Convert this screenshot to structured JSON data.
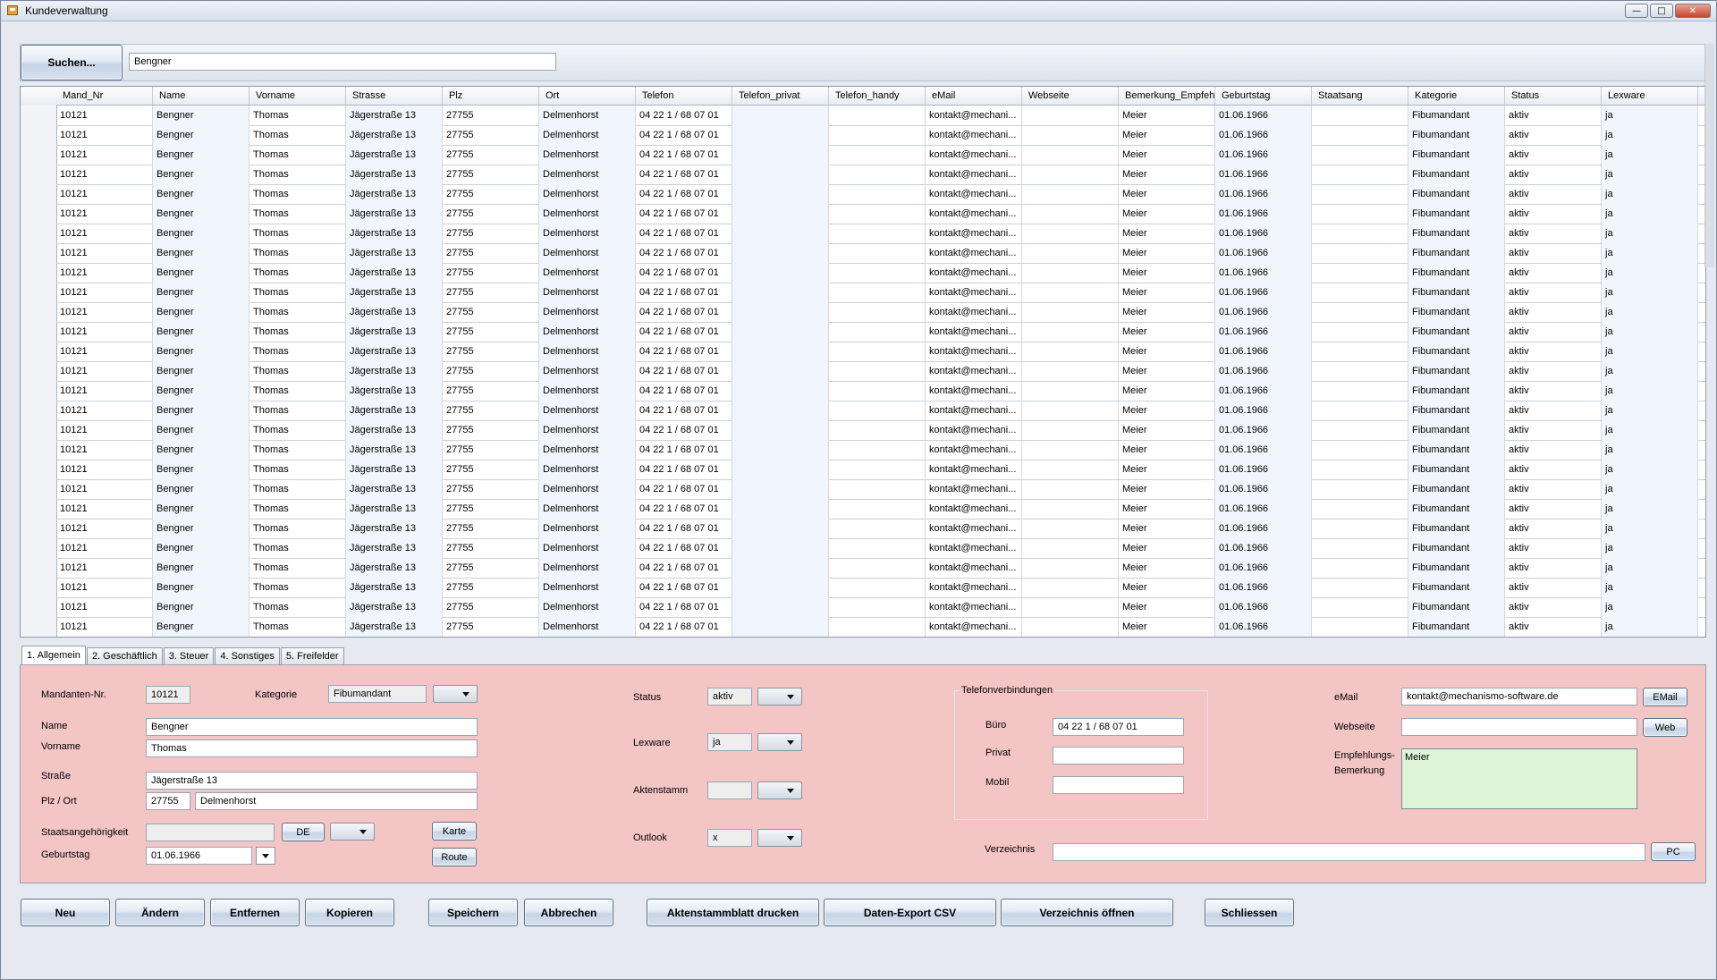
{
  "window": {
    "title": "Kundeverwaltung"
  },
  "search": {
    "button_label": "Suchen...",
    "value": "Bengner"
  },
  "grid": {
    "columns": [
      "Mand_Nr",
      "Name",
      "Vorname",
      "Strasse",
      "Plz",
      "Ort",
      "Telefon",
      "Telefon_privat",
      "Telefon_handy",
      "eMail",
      "Webseite",
      "Bemerkung_Empfehlung",
      "Geburtstag",
      "Staatsang",
      "Kategorie",
      "Status",
      "Lexware"
    ],
    "row_template": [
      "10121",
      "Bengner",
      "Thomas",
      "Jägerstraße 13",
      "27755",
      "Delmenhorst",
      "04 22 1 / 68 07 01",
      "",
      "",
      "kontakt@mechani...",
      "",
      "Meier",
      "01.06.1966",
      "",
      "Fibumandant",
      "aktiv",
      "ja"
    ],
    "row_count": 27
  },
  "tabs": [
    "1. Allgemein",
    "2. Geschäftlich",
    "3. Steuer",
    "4. Sonstiges",
    "5. Freifelder"
  ],
  "form": {
    "mandant_label": "Mandanten-Nr.",
    "mandant_value": "10121",
    "kategorie_label": "Kategorie",
    "kategorie_value": "Fibumandant",
    "name_label": "Name",
    "name_value": "Bengner",
    "vorname_label": "Vorname",
    "vorname_value": "Thomas",
    "strasse_label": "Straße",
    "strasse_value": "Jägerstraße 13",
    "plzort_label": "Plz / Ort",
    "plz_value": "27755",
    "ort_value": "Delmenhorst",
    "staat_label": "Staatsangehörigkeit",
    "staat_value": "",
    "de_button": "DE",
    "karte_button": "Karte",
    "geburtstag_label": "Geburtstag",
    "geburtstag_value": "01.06.1966",
    "route_button": "Route",
    "status_label": "Status",
    "status_value": "aktiv",
    "lexware_label": "Lexware",
    "lexware_value": "ja",
    "aktenstamm_label": "Aktenstamm",
    "aktenstamm_value": "",
    "outlook_label": "Outlook",
    "outlook_value": "x",
    "telefon_group": "Telefonverbindungen",
    "buero_label": "Büro",
    "buero_value": "04 22 1 / 68 07 01",
    "privat_label": "Privat",
    "privat_value": "",
    "mobil_label": "Mobil",
    "mobil_value": "",
    "email_label": "eMail",
    "email_value": "kontakt@mechanismo-software.de",
    "email_button": "EMail",
    "webseite_label": "Webseite",
    "webseite_value": "",
    "web_button": "Web",
    "empfehlung_label_1": "Empfehlungs-",
    "empfehlung_label_2": "Bemerkung",
    "empfehlung_value": "Meier",
    "verzeichnis_label": "Verzeichnis",
    "verzeichnis_value": "",
    "pc_button": "PC"
  },
  "actions": {
    "neu": "Neu",
    "aendern": "Ändern",
    "entfernen": "Entfernen",
    "kopieren": "Kopieren",
    "speichern": "Speichern",
    "abbrechen": "Abbrechen",
    "aktenstammblatt": "Aktenstammblatt drucken",
    "export": "Daten-Export CSV",
    "verzeichnis": "Verzeichnis öffnen",
    "schliessen": "Schliessen"
  },
  "colors": {
    "panel": "#f4c5c5",
    "memo": "#dff5d8",
    "alt_cell": "#f1f6fc"
  }
}
